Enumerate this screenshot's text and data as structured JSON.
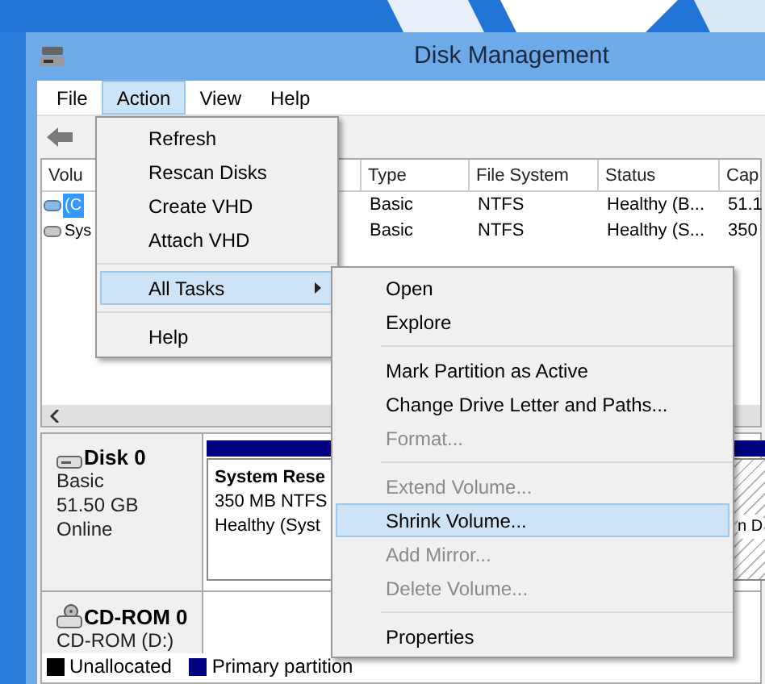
{
  "window": {
    "title": "Disk Management"
  },
  "menu_bar": [
    {
      "label": "File",
      "selected": false
    },
    {
      "label": "Action",
      "selected": true
    },
    {
      "label": "View",
      "selected": false
    },
    {
      "label": "Help",
      "selected": false
    }
  ],
  "volume_table": {
    "columns": [
      "Volu",
      "Type",
      "File System",
      "Status",
      "Cap"
    ],
    "rows": [
      {
        "cells": [
          "(C",
          "Basic",
          "NTFS",
          "Healthy (B...",
          "51.1"
        ],
        "selected": true
      },
      {
        "cells": [
          "Sys",
          "Basic",
          "NTFS",
          "Healthy (S...",
          "350"
        ],
        "selected": false
      }
    ]
  },
  "disks": [
    {
      "kind": "disk",
      "name": "Disk 0",
      "details": [
        "Basic",
        "51.50 GB",
        "Online"
      ],
      "partitions": [
        {
          "name": "System Rese",
          "details": [
            "350 MB NTFS",
            "Healthy (Syst"
          ],
          "selected": false
        },
        {
          "details": [
            "n D"
          ],
          "selected": true
        }
      ]
    },
    {
      "kind": "cdrom",
      "name": "CD-ROM 0",
      "details": [
        "CD-ROM (D:)"
      ]
    }
  ],
  "legend": [
    {
      "label": "Unallocated",
      "color": "#000000"
    },
    {
      "label": "Primary partition",
      "color": "#000080"
    }
  ],
  "action_menu": {
    "groups": [
      [
        {
          "label": "Refresh",
          "selected": false,
          "submenu": false
        },
        {
          "label": "Rescan Disks",
          "selected": false,
          "submenu": false
        },
        {
          "label": "Create VHD",
          "selected": false,
          "submenu": false
        },
        {
          "label": "Attach VHD",
          "selected": false,
          "submenu": false
        }
      ],
      [
        {
          "label": "All Tasks",
          "selected": true,
          "submenu": true
        }
      ],
      [
        {
          "label": "Help",
          "selected": false,
          "submenu": false
        }
      ]
    ]
  },
  "all_tasks_menu": {
    "groups": [
      [
        {
          "label": "Open",
          "selected": false,
          "disabled": false
        },
        {
          "label": "Explore",
          "selected": false,
          "disabled": false
        }
      ],
      [
        {
          "label": "Mark Partition as Active",
          "selected": false,
          "disabled": false
        },
        {
          "label": "Change Drive Letter and Paths...",
          "selected": false,
          "disabled": false
        },
        {
          "label": "Format...",
          "selected": false,
          "disabled": true
        }
      ],
      [
        {
          "label": "Extend Volume...",
          "selected": false,
          "disabled": true
        },
        {
          "label": "Shrink Volume...",
          "selected": true,
          "disabled": false
        },
        {
          "label": "Add Mirror...",
          "selected": false,
          "disabled": true
        },
        {
          "label": "Delete Volume...",
          "selected": false,
          "disabled": true
        }
      ],
      [
        {
          "label": "Properties",
          "selected": false,
          "disabled": false
        }
      ]
    ]
  }
}
